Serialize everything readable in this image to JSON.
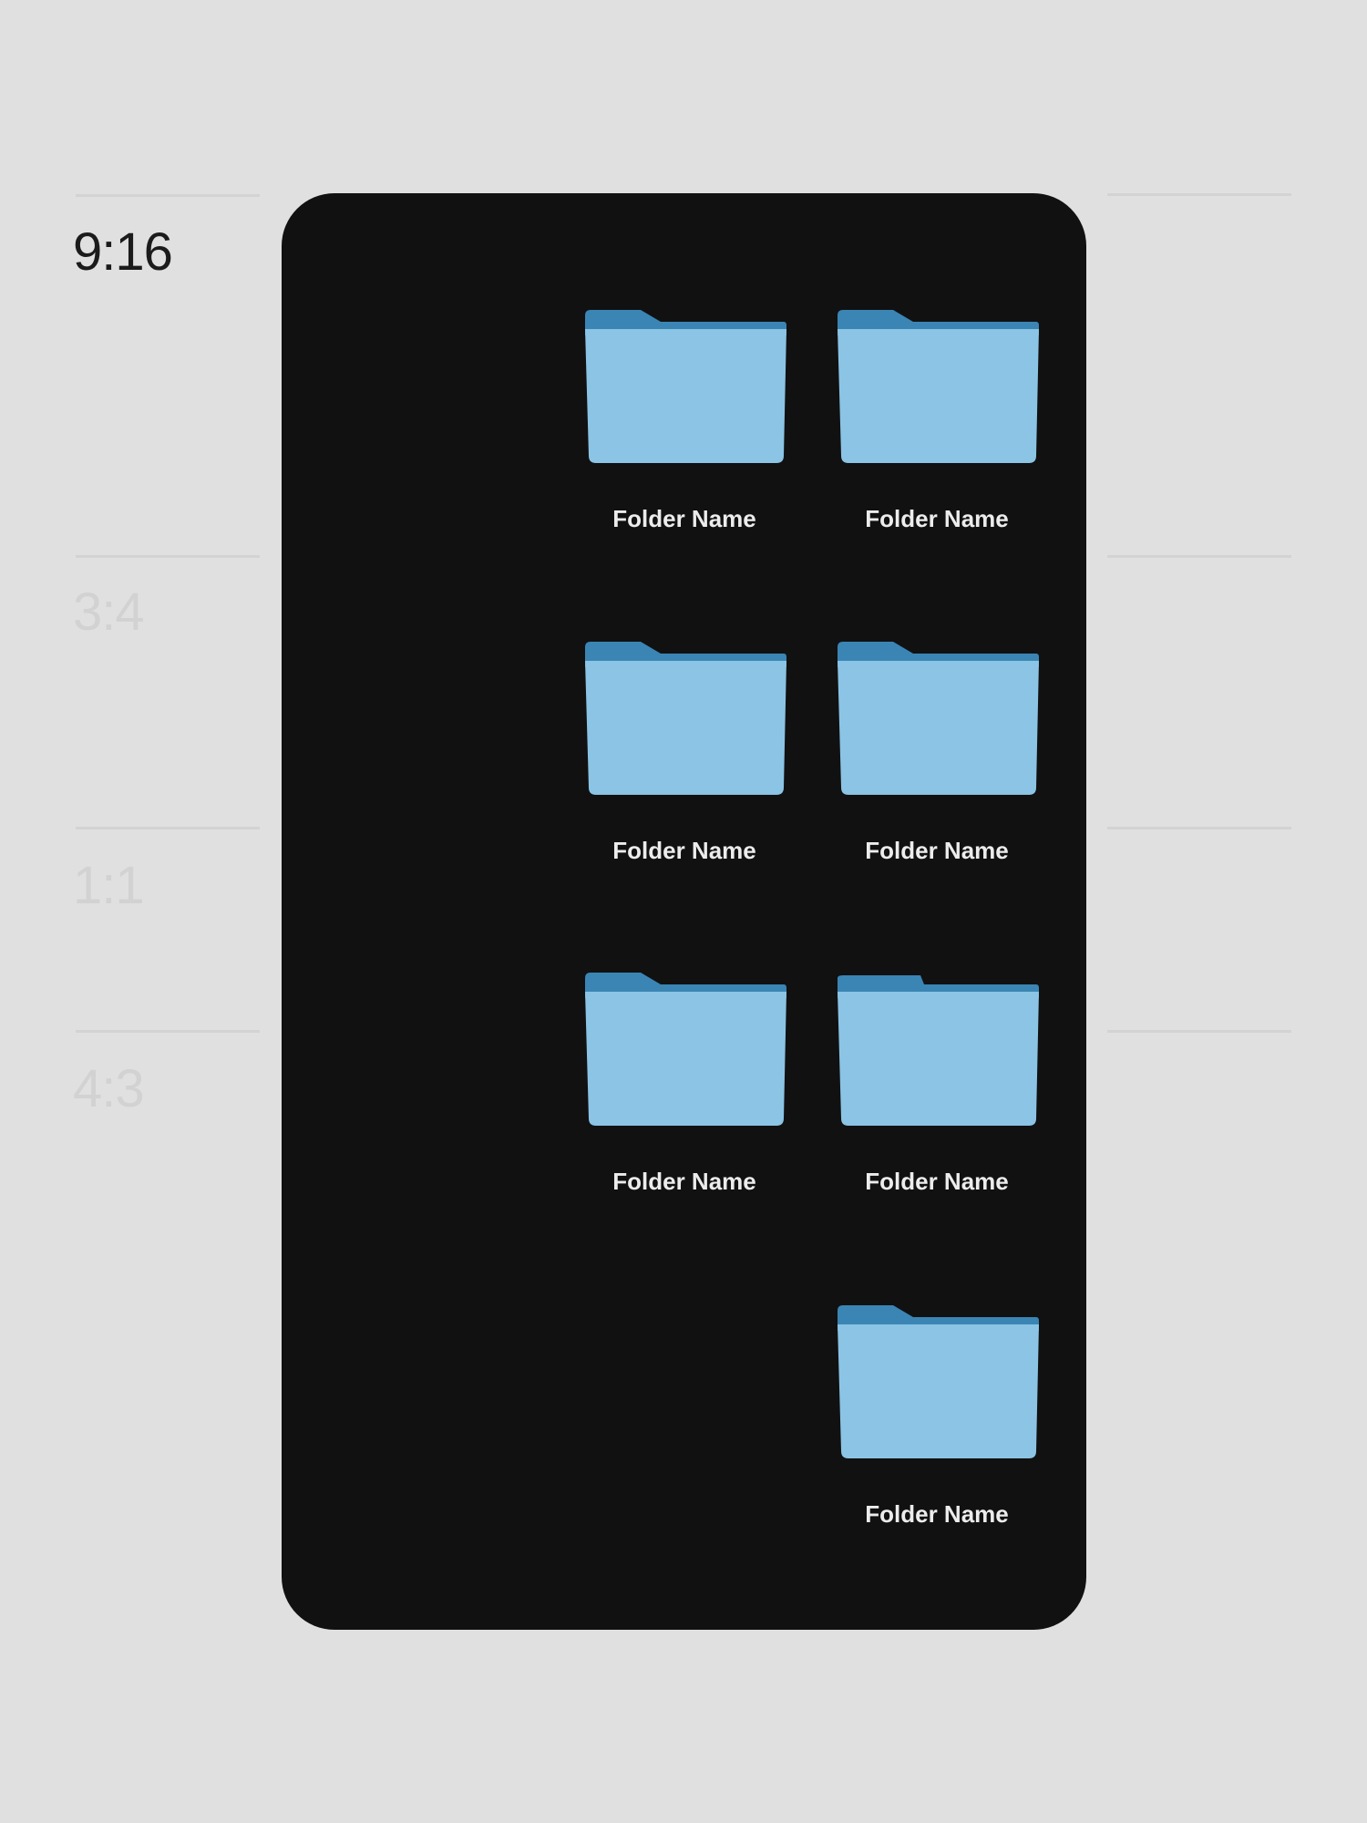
{
  "aspect_ratio_tabs": [
    {
      "label": "9:16",
      "active": true
    },
    {
      "label": "3:4",
      "active": false
    },
    {
      "label": "1:1",
      "active": false
    },
    {
      "label": "4:3",
      "active": false
    }
  ],
  "folders": [
    {
      "label": "Folder Name"
    },
    {
      "label": "Folder Name"
    },
    {
      "label": "Folder Name"
    },
    {
      "label": "Folder Name"
    },
    {
      "label": "Folder Name"
    },
    {
      "label": "Folder Name"
    },
    {
      "label": "Folder Name"
    }
  ],
  "colors": {
    "background": "#e0e0e0",
    "frame": "#111112",
    "folder_front": "#8bc4e4",
    "folder_back": "#3a85b4",
    "label_text": "#ececec"
  },
  "icons": {
    "folder": "folder-icon"
  }
}
